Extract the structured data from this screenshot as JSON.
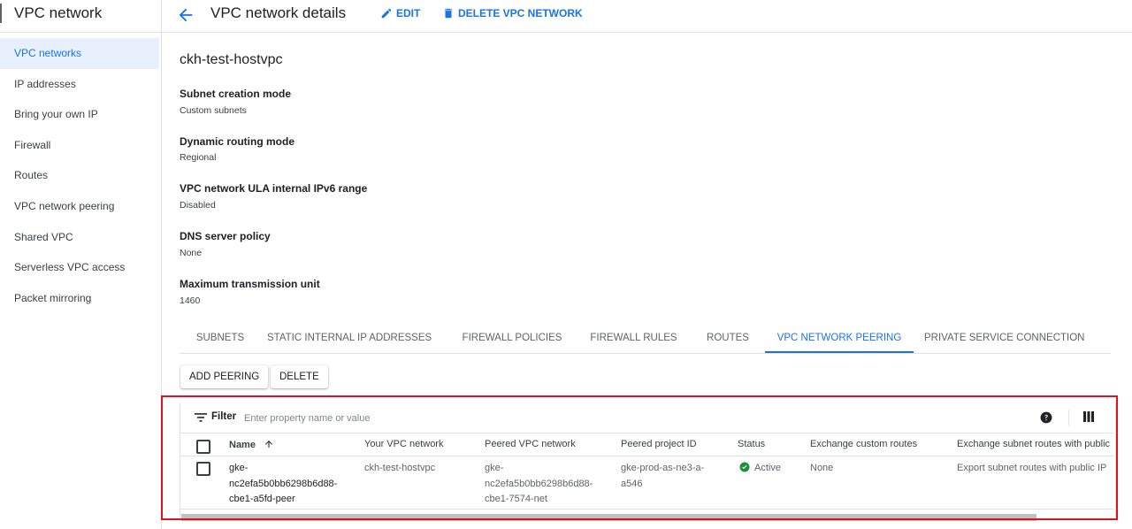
{
  "app": {
    "title": "VPC network"
  },
  "sidebar": {
    "items": [
      {
        "label": "VPC networks",
        "active": true
      },
      {
        "label": "IP addresses"
      },
      {
        "label": "Bring your own IP"
      },
      {
        "label": "Firewall"
      },
      {
        "label": "Routes"
      },
      {
        "label": "VPC network peering"
      },
      {
        "label": "Shared VPC"
      },
      {
        "label": "Serverless VPC access"
      },
      {
        "label": "Packet mirroring"
      }
    ]
  },
  "header": {
    "title": "VPC network details",
    "edit_label": "EDIT",
    "delete_label": "DELETE VPC NETWORK"
  },
  "network": {
    "name": "ckh-test-hostvpc",
    "properties": [
      {
        "label": "Subnet creation mode",
        "value": "Custom subnets"
      },
      {
        "label": "Dynamic routing mode",
        "value": "Regional"
      },
      {
        "label": "VPC network ULA internal IPv6 range",
        "value": "Disabled"
      },
      {
        "label": "DNS server policy",
        "value": "None"
      },
      {
        "label": "Maximum transmission unit",
        "value": "1460"
      }
    ]
  },
  "tabs": [
    {
      "label": "SUBNETS"
    },
    {
      "label": "STATIC INTERNAL IP ADDRESSES"
    },
    {
      "label": "FIREWALL POLICIES"
    },
    {
      "label": "FIREWALL RULES"
    },
    {
      "label": "ROUTES"
    },
    {
      "label": "VPC NETWORK PEERING",
      "active": true
    },
    {
      "label": "PRIVATE SERVICE CONNECTION"
    }
  ],
  "actions": {
    "add_label": "ADD PEERING",
    "delete_label": "DELETE"
  },
  "filter": {
    "label": "Filter",
    "placeholder": "Enter property name or value"
  },
  "table": {
    "columns": [
      "Name",
      "Your VPC network",
      "Peered VPC network",
      "Peered project ID",
      "Status",
      "Exchange custom routes",
      "Exchange subnet routes with public IP"
    ],
    "rows": [
      {
        "name_lines": [
          "gke-",
          "nc2efa5b0bb6298b6d88-",
          "cbe1-a5fd-peer"
        ],
        "your_vpc": "ckh-test-hostvpc",
        "peered_lines": [
          "gke-",
          "nc2efa5b0bb6298b6d88-",
          "cbe1-7574-net"
        ],
        "project_lines": [
          "gke-prod-as-ne3-a-",
          "a546"
        ],
        "status": "Active",
        "custom_routes": "None",
        "subnet_routes": "Export subnet routes with public IP"
      }
    ]
  },
  "colors": {
    "accent": "#1a73e8",
    "active_bg": "#e8f0fe",
    "status_green": "#1e8e3e",
    "highlight": "#e0121c"
  }
}
